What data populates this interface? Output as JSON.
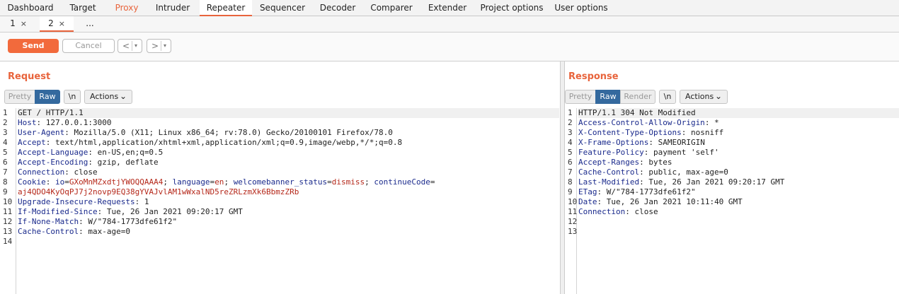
{
  "top_tabs": [
    "Dashboard",
    "Target",
    "Proxy",
    "Intruder",
    "Repeater",
    "Sequencer",
    "Decoder",
    "Comparer",
    "Extender",
    "Project options",
    "User options"
  ],
  "sub_tabs": [
    {
      "label": "1",
      "close": "×"
    },
    {
      "label": "2",
      "close": "×"
    },
    {
      "label": "..."
    }
  ],
  "toolbar": {
    "send": "Send",
    "cancel": "Cancel",
    "back": "<",
    "forward": ">",
    "dropdown": "▾"
  },
  "request": {
    "title": "Request",
    "tools": {
      "pretty": "Pretty",
      "raw": "Raw",
      "newline": "\\n",
      "actions": "Actions"
    },
    "line_numbers": [
      "1",
      "2",
      "3",
      "4",
      "5",
      "6",
      "7",
      "8",
      "9",
      "10",
      "11",
      "12",
      "13",
      "14"
    ],
    "lines": [
      {
        "value": "GET / HTTP/1.1"
      },
      {
        "key": "Host",
        "value": ": 127.0.0.1:3000"
      },
      {
        "key": "User-Agent",
        "value": ": Mozilla/5.0 (X11; Linux x86_64; rv:78.0) Gecko/20100101 Firefox/78.0"
      },
      {
        "key": "Accept",
        "value": ": text/html,application/xhtml+xml,application/xml;q=0.9,image/webp,*/*;q=0.8"
      },
      {
        "key": "Accept-Language",
        "value": ": en-US,en;q=0.5"
      },
      {
        "key": "Accept-Encoding",
        "value": ": gzip, deflate"
      },
      {
        "key": "Connection",
        "value": ": close"
      },
      {
        "key": "Cookie",
        "value": ": "
      },
      {
        "value": "aj4QDO4KyOqPJ7j2novp9EQ38gYVAJvlAM1wWxalND5reZRLzmXk6BbmzZRb"
      },
      {
        "key": "Upgrade-Insecure-Requests",
        "value": ": 1"
      },
      {
        "key": "If-Modified-Since",
        "value": ": Tue, 26 Jan 2021 09:20:17 GMT"
      },
      {
        "key": "If-None-Match",
        "value": ": W/\"784-1773dfe61f2\""
      },
      {
        "key": "Cache-Control",
        "value": ": max-age=0"
      },
      {
        "value": ""
      }
    ],
    "cookies": [
      {
        "name": "io",
        "eq": "=",
        "value": "GXoMnMZxdtjYWOQQAAA4",
        "sep": "; "
      },
      {
        "name": "language",
        "eq": "=",
        "value": "en",
        "sep": "; "
      },
      {
        "name": "welcomebanner_status",
        "eq": "=",
        "value": "dismiss",
        "sep": "; "
      },
      {
        "name": "continueCode",
        "eq": "=",
        "value": "",
        "sep": ""
      }
    ]
  },
  "response": {
    "title": "Response",
    "tools": {
      "pretty": "Pretty",
      "raw": "Raw",
      "render": "Render",
      "newline": "\\n",
      "actions": "Actions"
    },
    "line_numbers": [
      "1",
      "2",
      "3",
      "4",
      "5",
      "6",
      "7",
      "8",
      "9",
      "10",
      "11",
      "12",
      "13"
    ],
    "lines": [
      {
        "value": "HTTP/1.1 304 Not Modified"
      },
      {
        "key": "Access-Control-Allow-Origin",
        "value": ": *"
      },
      {
        "key": "X-Content-Type-Options",
        "value": ": nosniff"
      },
      {
        "key": "X-Frame-Options",
        "value": ": SAMEORIGIN"
      },
      {
        "key": "Feature-Policy",
        "value": ": payment 'self'"
      },
      {
        "key": "Accept-Ranges",
        "value": ": bytes"
      },
      {
        "key": "Cache-Control",
        "value": ": public, max-age=0"
      },
      {
        "key": "Last-Modified",
        "value": ": Tue, 26 Jan 2021 09:20:17 GMT"
      },
      {
        "key": "ETag",
        "value": ": W/\"784-1773dfe61f2\""
      },
      {
        "key": "Date",
        "value": ": Tue, 26 Jan 2021 10:11:40 GMT"
      },
      {
        "key": "Connection",
        "value": ": close"
      },
      {
        "value": ""
      },
      {
        "value": ""
      }
    ]
  },
  "colors": {
    "accent": "#e8643c",
    "selected": "#34699e",
    "header_key": "#1a2a8c",
    "cookie_value": "#b5281a"
  }
}
